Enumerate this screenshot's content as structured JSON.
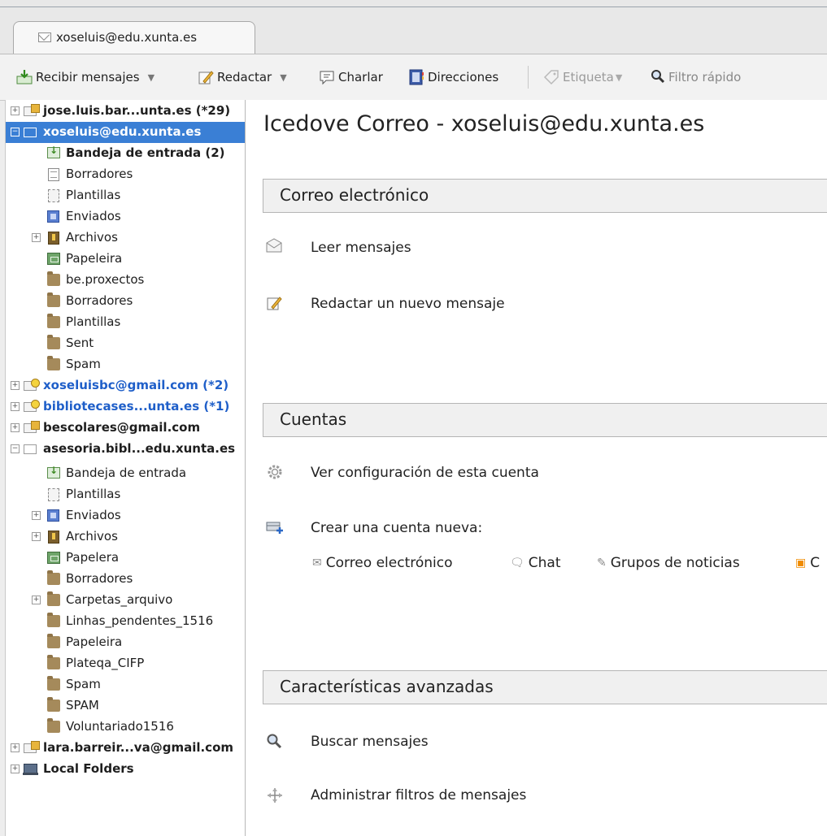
{
  "tabs": [
    {
      "label": "xoseluis@edu.xunta.es"
    }
  ],
  "toolbar": {
    "get_messages": "Recibir mensajes",
    "write": "Redactar",
    "chat": "Charlar",
    "address_book": "Direcciones",
    "tag": "Etiqueta",
    "quick_filter": "Filtro rápido"
  },
  "folders": [
    {
      "label": "jose.luis.bar...unta.es (*29)"
    },
    {
      "label": "xoseluis@edu.xunta.es"
    },
    {
      "label": "Bandeja de entrada (2)"
    },
    {
      "label": "Borradores"
    },
    {
      "label": "Plantillas"
    },
    {
      "label": "Enviados"
    },
    {
      "label": "Archivos"
    },
    {
      "label": "Papeleira"
    },
    {
      "label": "be.proxectos"
    },
    {
      "label": "Borradores"
    },
    {
      "label": "Plantillas"
    },
    {
      "label": "Sent"
    },
    {
      "label": "Spam"
    },
    {
      "label": "xoseluisbc@gmail.com (*2)"
    },
    {
      "label": "bibliotecases...unta.es (*1)"
    },
    {
      "label": "bescolares@gmail.com"
    },
    {
      "label": "asesoria.bibl...edu.xunta.es"
    },
    {
      "label": "Bandeja de entrada"
    },
    {
      "label": "Plantillas"
    },
    {
      "label": "Enviados"
    },
    {
      "label": "Archivos"
    },
    {
      "label": "Papelera"
    },
    {
      "label": "Borradores"
    },
    {
      "label": "Carpetas_arquivo"
    },
    {
      "label": "Linhas_pendentes_1516"
    },
    {
      "label": "Papeleira"
    },
    {
      "label": "Plateqa_CIFP"
    },
    {
      "label": "Spam"
    },
    {
      "label": "SPAM"
    },
    {
      "label": "Voluntariado1516"
    },
    {
      "label": "lara.barreir...va@gmail.com"
    },
    {
      "label": "Local Folders"
    }
  ],
  "content": {
    "title": "Icedove Correo - xoseluis@edu.xunta.es",
    "email_section": "Correo electrónico",
    "read_messages": "Leer mensajes",
    "compose_new": "Redactar un nuevo mensaje",
    "accounts_section": "Cuentas",
    "view_settings": "Ver configuración de esta cuenta",
    "create_account": "Crear una cuenta nueva:",
    "create_options": {
      "email": "Correo electrónico",
      "chat": "Chat",
      "newsgroups": "Grupos de noticias",
      "feeds_partial": "C"
    },
    "advanced_section": "Características avanzadas",
    "search_messages": "Buscar mensajes",
    "manage_filters": "Administrar filtros de mensajes"
  },
  "colors": {
    "selection": "#3a7fd5",
    "unread_account": "#1f5fc9"
  }
}
